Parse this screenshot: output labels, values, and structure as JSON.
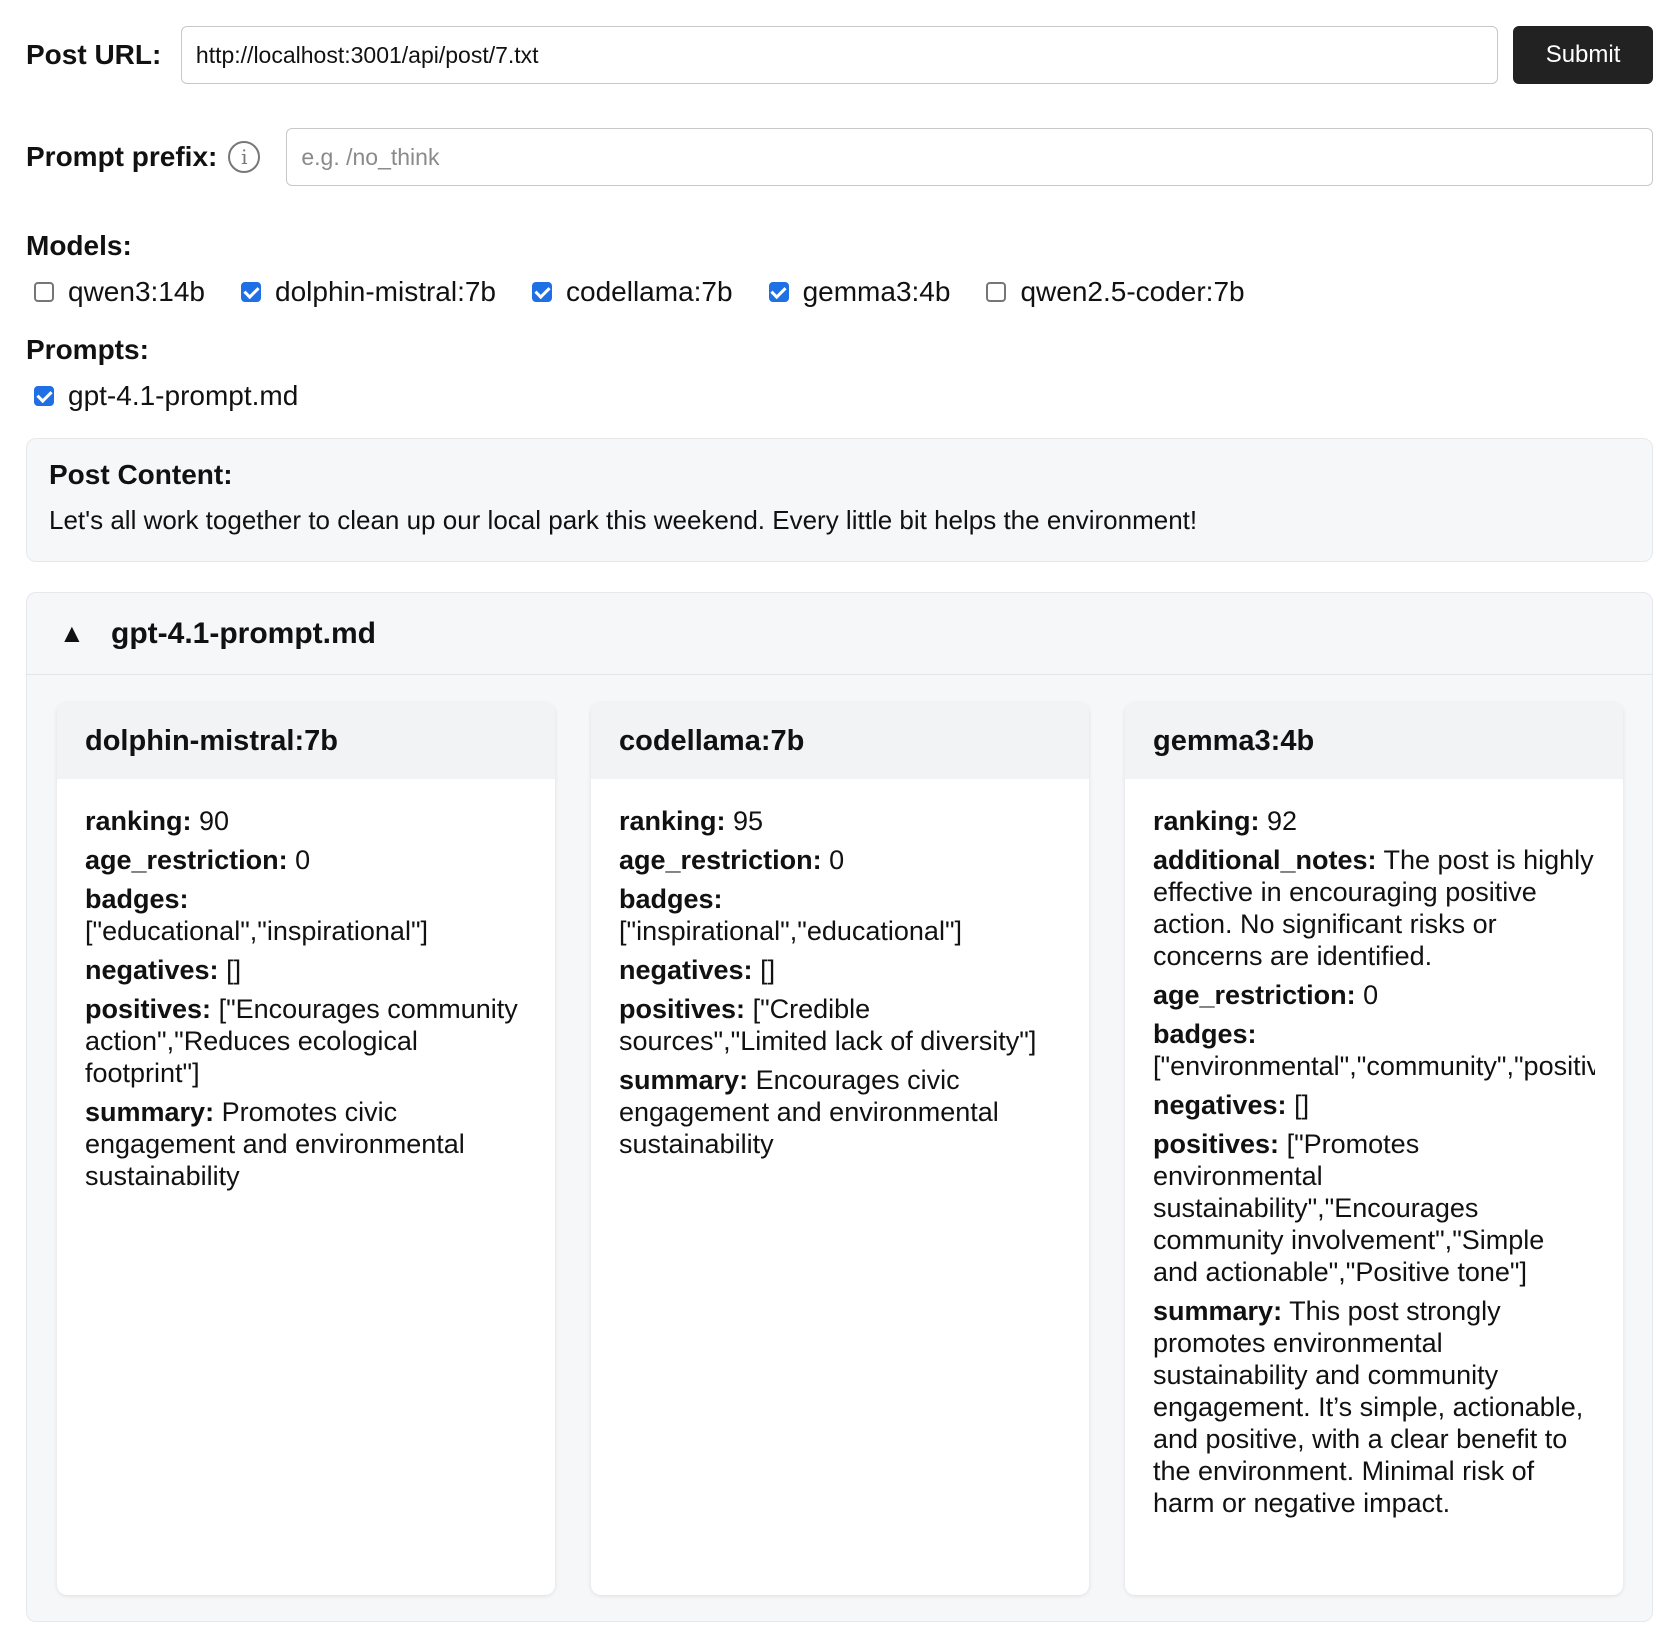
{
  "form": {
    "url_label": "Post URL:",
    "url_value": "http://localhost:3001/api/post/7.txt",
    "submit_label": "Submit",
    "prefix_label": "Prompt prefix:",
    "prefix_placeholder": "e.g. /no_think",
    "info_icon": "info-icon"
  },
  "models": {
    "label": "Models:",
    "items": [
      {
        "label": "qwen3:14b",
        "checked": false
      },
      {
        "label": "dolphin-mistral:7b",
        "checked": true
      },
      {
        "label": "codellama:7b",
        "checked": true
      },
      {
        "label": "gemma3:4b",
        "checked": true
      },
      {
        "label": "qwen2.5-coder:7b",
        "checked": false
      }
    ]
  },
  "prompts": {
    "label": "Prompts:",
    "items": [
      {
        "label": "gpt-4.1-prompt.md",
        "checked": true
      }
    ]
  },
  "post": {
    "title": "Post Content:",
    "text": "Let's all work together to clean up our local park this weekend. Every little bit helps the environment!"
  },
  "accordion": {
    "expanded_icon": "▲",
    "title": "gpt-4.1-prompt.md",
    "cards": [
      {
        "model": "dolphin-mistral:7b",
        "fields": [
          {
            "key": "ranking:",
            "value": "90"
          },
          {
            "key": "age_restriction:",
            "value": "0"
          },
          {
            "key": "badges:",
            "value": "[\"educational\",\"inspirational\"]"
          },
          {
            "key": "negatives:",
            "value": "[]"
          },
          {
            "key": "positives:",
            "value": "[\"Encourages community action\",\"Reduces ecological footprint\"]"
          },
          {
            "key": "summary:",
            "value": "Promotes civic engagement and environmental sustainability"
          }
        ]
      },
      {
        "model": "codellama:7b",
        "fields": [
          {
            "key": "ranking:",
            "value": "95"
          },
          {
            "key": "age_restriction:",
            "value": "0"
          },
          {
            "key": "badges:",
            "value": "[\"inspirational\",\"educational\"]"
          },
          {
            "key": "negatives:",
            "value": "[]"
          },
          {
            "key": "positives:",
            "value": "[\"Credible sources\",\"Limited lack of diversity\"]"
          },
          {
            "key": "summary:",
            "value": "Encourages civic engagement and environmental sustainability"
          }
        ]
      },
      {
        "model": "gemma3:4b",
        "fields": [
          {
            "key": "ranking:",
            "value": "92"
          },
          {
            "key": "additional_notes:",
            "value": "The post is highly effective in encouraging positive action. No significant risks or concerns are identified."
          },
          {
            "key": "age_restriction:",
            "value": "0"
          },
          {
            "key": "badges:",
            "value": "[\"environmental\",\"community\",\"positiv"
          },
          {
            "key": "negatives:",
            "value": "[]"
          },
          {
            "key": "positives:",
            "value": "[\"Promotes environmental sustainability\",\"Encourages community involvement\",\"Simple and actionable\",\"Positive tone\"]"
          },
          {
            "key": "summary:",
            "value": "This post strongly promotes environmental sustainability and community engagement. It’s simple, actionable, and positive, with a clear benefit to the environment. Minimal risk of harm or negative impact."
          }
        ]
      }
    ]
  },
  "colors": {
    "accent": "#1f6fe5",
    "button_bg": "#222222",
    "panel_bg": "#f6f7f9"
  }
}
